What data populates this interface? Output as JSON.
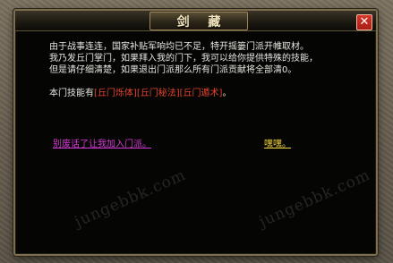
{
  "dialog": {
    "title": "剑 藏",
    "close_label": "✕",
    "lines": [
      "由于战事连连，国家补贴军响均已不足，特开摇篓门派开帷取材。",
      "我乃发丘门掌门，如果拜入我的门下，我可以给你提供特殊的技能，",
      "但是请仔细清楚，如果退出门派那么所有门派贡献将全部清0。"
    ],
    "skills_prefix": "本门技能有",
    "skills": [
      "[丘门烁体]",
      "[丘门秘法]",
      "[丘门遁术]"
    ],
    "skills_suffix": "。",
    "join_link": "别废话了让我加入门派。",
    "leave_link": "嘿嘿。"
  },
  "watermarks": [
    "jungebbk.com",
    "jungebbk.com"
  ],
  "colors": {
    "skill": "#e6452f",
    "join_link": "#d63ad6",
    "leave_link": "#f2d33c",
    "close_button": "#c42a1e"
  }
}
